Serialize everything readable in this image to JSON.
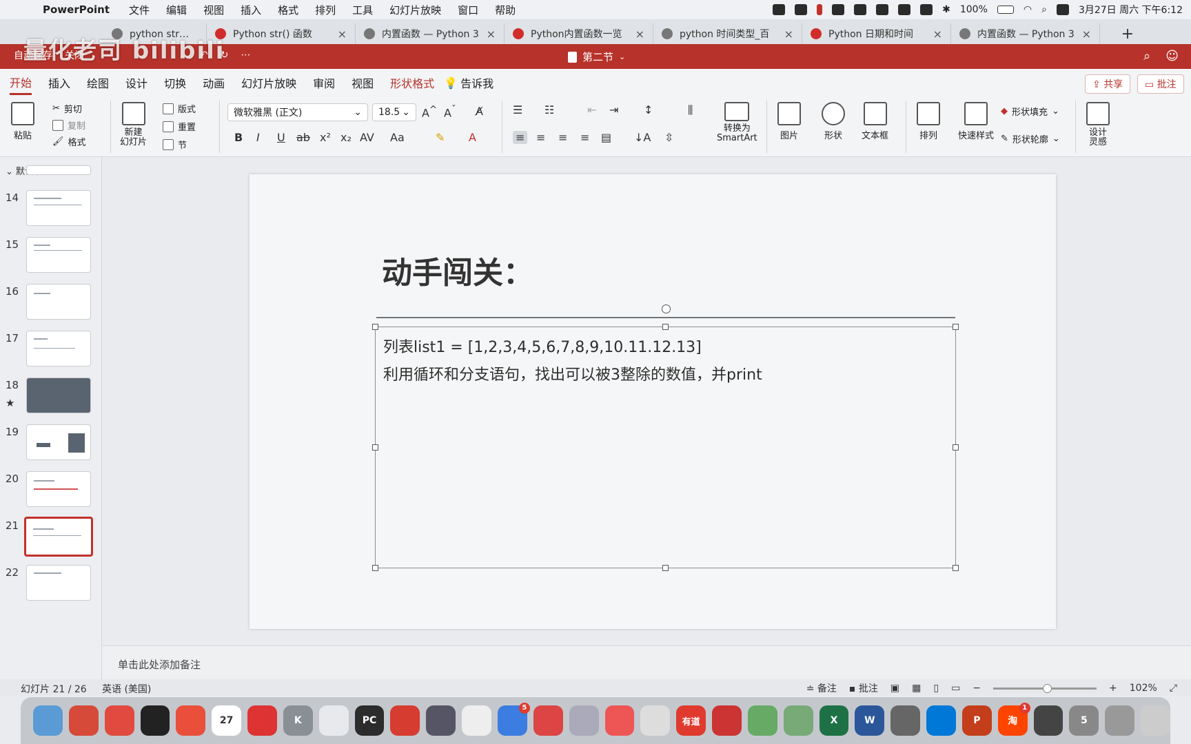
{
  "menubar": {
    "app": "PowerPoint",
    "items": [
      "文件",
      "编辑",
      "视图",
      "插入",
      "格式",
      "排列",
      "工具",
      "幻灯片放映",
      "窗口",
      "帮助"
    ],
    "battery": "100%",
    "datetime": "3月27日 周六 下午6:12"
  },
  "browser_tabs": [
    {
      "title": "python str函数_百"
    },
    {
      "title": "Python str() 函数"
    },
    {
      "title": "内置函数 — Python 3"
    },
    {
      "title": "Python内置函数一览"
    },
    {
      "title": "python 时间类型_百"
    },
    {
      "title": "Python 日期和时间"
    },
    {
      "title": "内置函数 — Python 3"
    }
  ],
  "watermark": "量化老司 bilibili",
  "titlebar": {
    "doc_title": "第二节",
    "autosave": "自动保存",
    "off": "关闭"
  },
  "ribbon_tabs": [
    "开始",
    "插入",
    "绘图",
    "设计",
    "切换",
    "动画",
    "幻灯片放映",
    "审阅",
    "视图",
    "形状格式",
    "告诉我"
  ],
  "share_label": "共享",
  "comments_label": "批注",
  "ribbon": {
    "paste": "粘贴",
    "cut": "剪切",
    "copy": "复制",
    "format": "格式",
    "new_slide": "新建\n幻灯片",
    "layout": "版式",
    "reset": "重置",
    "section": "节",
    "font_name": "微软雅黑 (正文)",
    "font_size": "18.5",
    "convert_smartart": "转换为\nSmartArt",
    "picture": "图片",
    "shape": "形状",
    "textbox": "文本框",
    "arrange": "排列",
    "quick_styles": "快速样式",
    "shape_fill": "形状填充",
    "shape_outline": "形状轮廓",
    "designer": "设计\n灵感"
  },
  "sidebar": {
    "section": "默认节",
    "slides": [
      "14",
      "15",
      "16",
      "17",
      "18",
      "19",
      "20",
      "21",
      "22"
    ],
    "selected": "21"
  },
  "slide": {
    "title": "动手闯关：",
    "line1": "列表list1 = [1,2,3,4,5,6,7,8,9,10.11.12.13]",
    "line2": "利用循环和分支语句，找出可以被3整除的数值，并print"
  },
  "notes_placeholder": "单击此处添加备注",
  "status": {
    "slide_counter": "幻灯片 21 / 26",
    "language": "英语 (美国)",
    "notes": "备注",
    "comments": "批注",
    "zoom": "102%"
  },
  "dock": [
    "",
    "",
    "",
    "",
    "",
    "27",
    "",
    "K",
    "",
    "PC",
    "",
    "",
    "",
    "",
    "",
    "",
    "",
    "",
    "有道",
    "",
    "",
    "",
    "X",
    "W",
    "",
    "",
    "P",
    "淘",
    "",
    "5",
    "",
    ""
  ]
}
